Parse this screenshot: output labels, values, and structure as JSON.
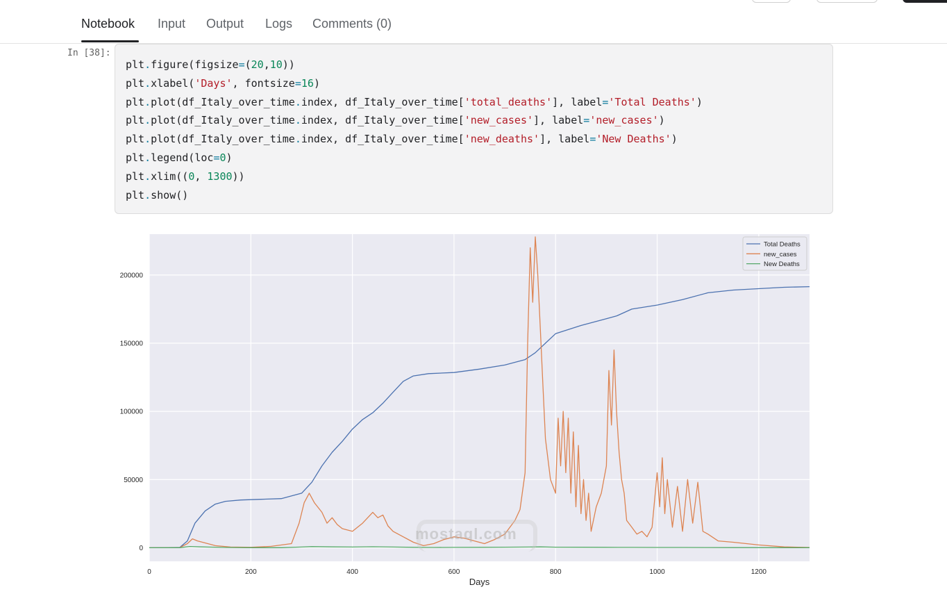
{
  "tabs": [
    {
      "label": "Notebook",
      "active": true
    },
    {
      "label": "Input",
      "active": false
    },
    {
      "label": "Output",
      "active": false
    },
    {
      "label": "Logs",
      "active": false
    },
    {
      "label": "Comments (0)",
      "active": false
    }
  ],
  "cell": {
    "prompt": "In [38]:",
    "code_lines": [
      "plt.figure(figsize=(20,10))",
      "plt.xlabel('Days', fontsize=16)",
      "plt.plot(df_Italy_over_time.index, df_Italy_over_time['total_deaths'], label='Total Deaths')",
      "plt.plot(df_Italy_over_time.index, df_Italy_over_time['new_cases'], label='new_cases')",
      "plt.plot(df_Italy_over_time.index, df_Italy_over_time['new_deaths'], label='New Deaths')",
      "plt.legend(loc=0)",
      "plt.xlim((0, 1300))",
      "plt.show()"
    ]
  },
  "watermark": "mostaql.com",
  "colors": {
    "total_deaths": "#4c72b0",
    "new_cases": "#dd8452",
    "new_deaths": "#55a868",
    "plot_bg": "#eaeaf2"
  },
  "chart_data": {
    "type": "line",
    "xlabel": "Days",
    "ylabel": "",
    "xlim": [
      0,
      1300
    ],
    "ylim": [
      -10000,
      230000
    ],
    "xticks": [
      0,
      200,
      400,
      600,
      800,
      1000,
      1200
    ],
    "yticks": [
      0,
      50000,
      100000,
      150000,
      200000
    ],
    "grid": true,
    "legend_position": "top-right",
    "series": [
      {
        "name": "Total Deaths",
        "x": [
          0,
          60,
          75,
          90,
          110,
          130,
          150,
          180,
          220,
          260,
          300,
          320,
          340,
          360,
          380,
          400,
          420,
          440,
          460,
          480,
          500,
          520,
          550,
          600,
          650,
          700,
          740,
          760,
          780,
          800,
          850,
          900,
          920,
          950,
          1000,
          1050,
          1100,
          1150,
          1200,
          1250,
          1300
        ],
        "y": [
          0,
          200,
          5000,
          18000,
          27000,
          32000,
          34000,
          35000,
          35500,
          36000,
          40000,
          48000,
          60000,
          70000,
          78000,
          87000,
          94000,
          99000,
          106000,
          114000,
          122000,
          126000,
          127700,
          128500,
          131000,
          134000,
          138000,
          143000,
          150000,
          157000,
          163000,
          168000,
          170000,
          175000,
          178000,
          182000,
          187000,
          189000,
          190000,
          191000,
          191500
        ]
      },
      {
        "name": "new_cases",
        "x": [
          0,
          60,
          75,
          85,
          95,
          110,
          130,
          160,
          200,
          240,
          280,
          295,
          305,
          315,
          325,
          340,
          350,
          360,
          370,
          380,
          400,
          420,
          430,
          440,
          450,
          460,
          470,
          480,
          500,
          520,
          540,
          560,
          580,
          600,
          620,
          640,
          660,
          680,
          700,
          720,
          730,
          740,
          745,
          750,
          755,
          760,
          765,
          770,
          775,
          780,
          790,
          800,
          805,
          810,
          815,
          820,
          825,
          830,
          835,
          840,
          845,
          850,
          855,
          860,
          865,
          870,
          880,
          890,
          900,
          905,
          910,
          915,
          920,
          925,
          930,
          935,
          940,
          950,
          960,
          970,
          980,
          990,
          1000,
          1005,
          1010,
          1015,
          1020,
          1030,
          1040,
          1050,
          1060,
          1070,
          1080,
          1090,
          1100,
          1120,
          1150,
          1200,
          1250,
          1300
        ],
        "y": [
          0,
          100,
          3000,
          6500,
          5000,
          3500,
          1500,
          500,
          300,
          1000,
          3000,
          18000,
          33000,
          40000,
          33000,
          26000,
          18000,
          22000,
          17000,
          14000,
          12000,
          18000,
          22000,
          26000,
          22000,
          24000,
          16000,
          12000,
          8000,
          4000,
          1500,
          3000,
          6000,
          8000,
          7000,
          5000,
          3000,
          6000,
          10000,
          20000,
          28000,
          55000,
          150000,
          220000,
          180000,
          228000,
          200000,
          160000,
          120000,
          80000,
          50000,
          40000,
          95000,
          60000,
          100000,
          55000,
          95000,
          40000,
          85000,
          30000,
          75000,
          25000,
          50000,
          20000,
          40000,
          12000,
          30000,
          40000,
          60000,
          130000,
          90000,
          145000,
          100000,
          70000,
          50000,
          40000,
          20000,
          15000,
          10000,
          12000,
          8000,
          15000,
          55000,
          30000,
          66000,
          25000,
          50000,
          15000,
          45000,
          12000,
          50000,
          18000,
          48000,
          12000,
          10000,
          5000,
          4000,
          2000,
          600,
          200
        ]
      },
      {
        "name": "New Deaths",
        "x": [
          0,
          60,
          80,
          100,
          150,
          200,
          260,
          300,
          320,
          360,
          400,
          440,
          480,
          520,
          560,
          600,
          650,
          700,
          750,
          770,
          800,
          850,
          900,
          950,
          1000,
          1050,
          1100,
          1150,
          1200,
          1250,
          1300
        ],
        "y": [
          0,
          50,
          900,
          600,
          200,
          50,
          50,
          500,
          800,
          600,
          500,
          700,
          500,
          300,
          200,
          250,
          300,
          400,
          500,
          600,
          400,
          350,
          300,
          250,
          200,
          200,
          150,
          100,
          80,
          60,
          50
        ]
      }
    ]
  }
}
